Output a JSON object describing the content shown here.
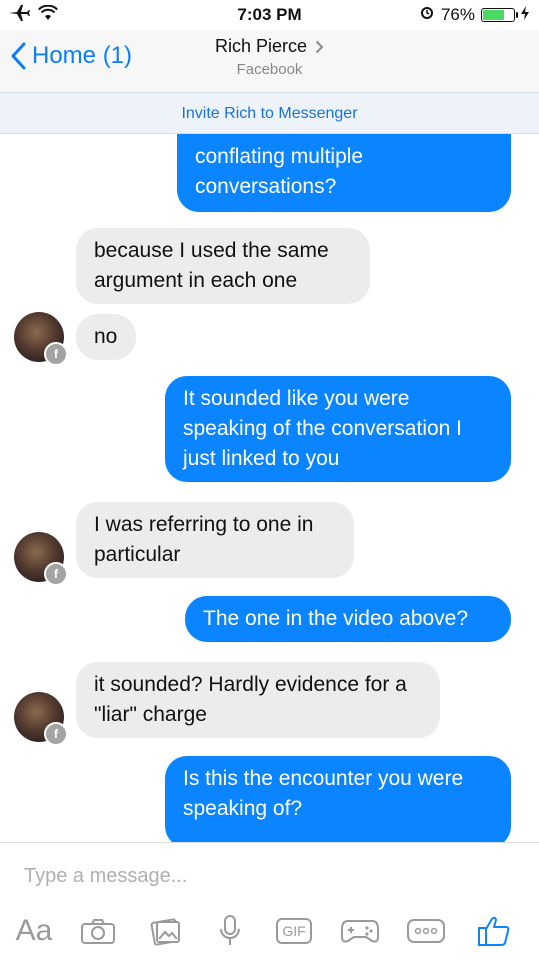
{
  "status_bar": {
    "time": "7:03 PM",
    "battery_percent": "76%",
    "battery_level": 0.76
  },
  "header": {
    "back_label": "Home (1)",
    "contact_name": "Rich Pierce",
    "contact_subtitle": "Facebook"
  },
  "invite_banner": "Invite Rich to Messenger",
  "messages": [
    {
      "direction": "out",
      "text": "conflating multiple conversations?"
    },
    {
      "direction": "in",
      "text": "because I used the same argument in each one"
    },
    {
      "direction": "in",
      "text": "no"
    },
    {
      "direction": "out",
      "text": "It sounded like you were speaking of the conversation I just linked to you"
    },
    {
      "direction": "in",
      "text": "I was referring to one in particular"
    },
    {
      "direction": "out",
      "text": "The one in the video above?"
    },
    {
      "direction": "in",
      "text": "it sounded? Hardly evidence for a \"liar\" charge"
    },
    {
      "direction": "out",
      "text": "Is this the encounter you were speaking of?"
    }
  ],
  "composer": {
    "placeholder": "Type a message...",
    "tools": [
      "text-format-icon",
      "camera-icon",
      "photos-icon",
      "microphone-icon",
      "gif-icon",
      "games-icon",
      "more-icon",
      "like-icon"
    ],
    "aa_label": "Aa",
    "gif_label": "GIF"
  },
  "colors": {
    "accent": "#0a84ff",
    "incoming_bubble": "#ececec",
    "banner_text": "#1a73d9"
  }
}
